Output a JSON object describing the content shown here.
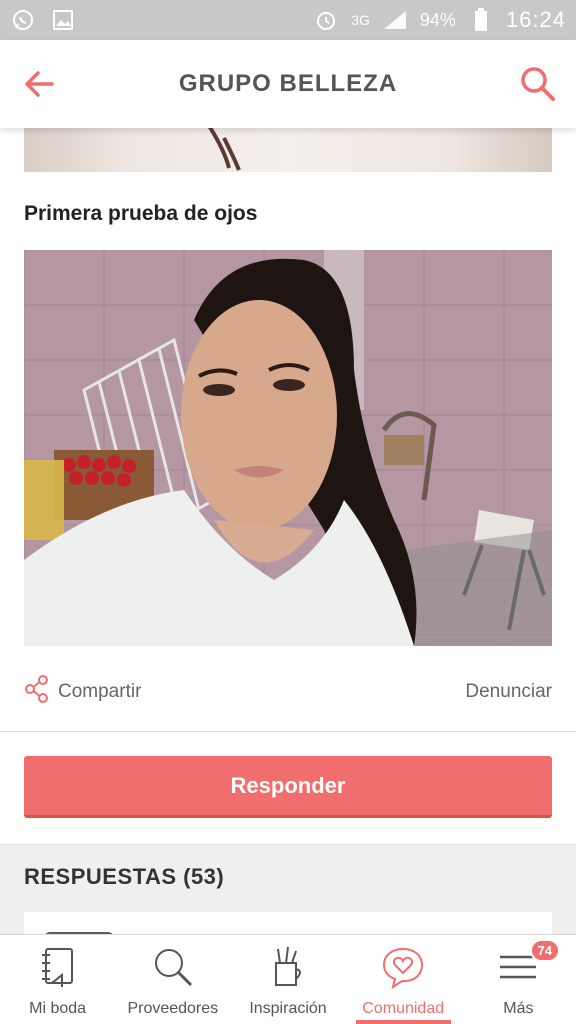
{
  "status_bar": {
    "icons_left": [
      "whatsapp-icon",
      "image-icon"
    ],
    "network": "3G",
    "battery": "94%",
    "time": "16:24"
  },
  "header": {
    "title": "GRUPO BELLEZA",
    "back_icon": "arrow-left-icon",
    "search_icon": "search-icon"
  },
  "post": {
    "title": "Primera prueba de ojos",
    "share_label": "Compartir",
    "report_label": "Denunciar",
    "reply_label": "Responder"
  },
  "responses": {
    "title": "RESPUESTAS (53)"
  },
  "bottom_nav": {
    "items": [
      {
        "label": "Mi boda",
        "icon": "notebook-icon"
      },
      {
        "label": "Proveedores",
        "icon": "search-icon"
      },
      {
        "label": "Inspiración",
        "icon": "pencil-cup-icon"
      },
      {
        "label": "Comunidad",
        "icon": "heart-chat-icon"
      },
      {
        "label": "Más",
        "icon": "menu-icon",
        "badge": "74"
      }
    ],
    "active": "Comunidad"
  },
  "colors": {
    "accent": "#f26d6d",
    "status_bar": "#c8c8c8"
  }
}
